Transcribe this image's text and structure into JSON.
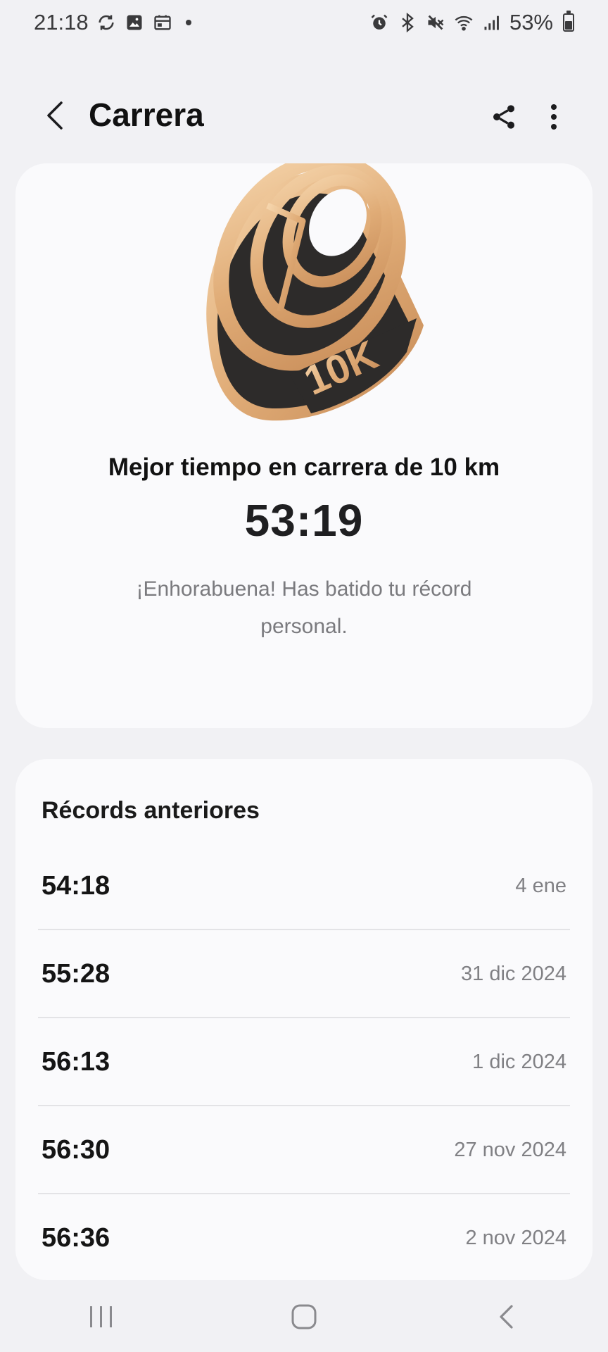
{
  "status": {
    "time": "21:18",
    "battery": "53%",
    "battery_level": 0.53,
    "left_icons": [
      "sync-icon",
      "gallery-icon",
      "calendar-icon"
    ],
    "right_icons": [
      "alarm-icon",
      "bluetooth-icon",
      "mute-icon",
      "wifi-icon",
      "signal-icon"
    ]
  },
  "header": {
    "title": "Carrera"
  },
  "hero": {
    "medal_label": "10K",
    "heading": "Mejor tiempo en carrera de 10 km",
    "time": "53:19",
    "message": "¡Enhorabuena! Has batido tu récord personal."
  },
  "records": {
    "title": "Récords anteriores",
    "items": [
      {
        "time": "54:18",
        "date": "4 ene"
      },
      {
        "time": "55:28",
        "date": "31 dic 2024"
      },
      {
        "time": "56:13",
        "date": "1 dic 2024"
      },
      {
        "time": "56:30",
        "date": "27 nov 2024"
      },
      {
        "time": "56:36",
        "date": "2 nov 2024"
      }
    ]
  },
  "colors": {
    "gold": "#e2b27e",
    "dark": "#2d2b2a",
    "background": "#f1f1f4",
    "card": "#fafafc"
  }
}
